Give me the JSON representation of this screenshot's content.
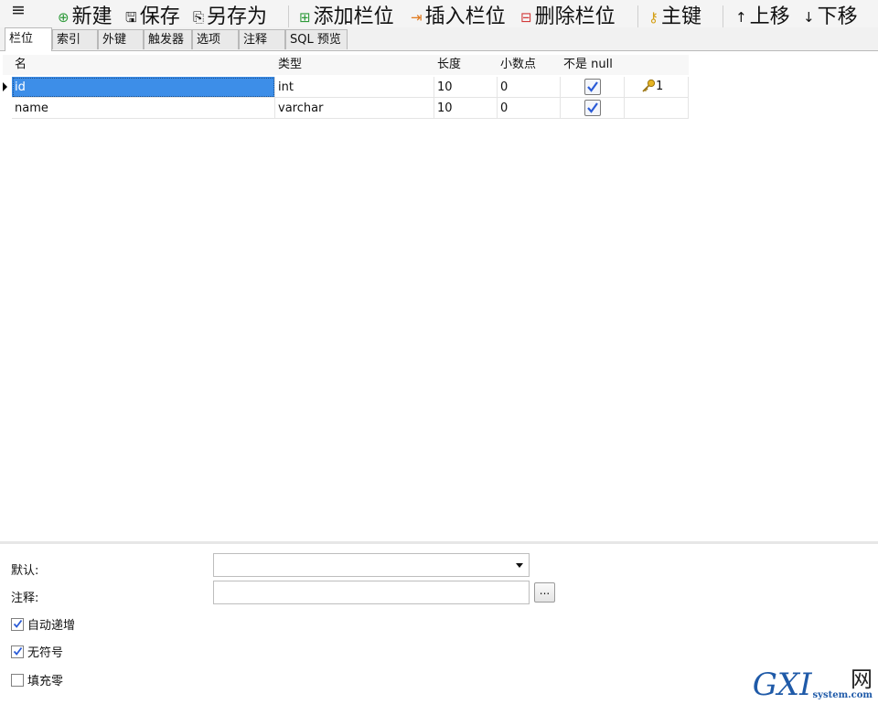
{
  "toolbar": {
    "menu_icon": "≡",
    "buttons": [
      {
        "label": "新建"
      },
      {
        "label": "保存"
      },
      {
        "label": "另存为"
      },
      {
        "label": "添加栏位"
      },
      {
        "label": "插入栏位"
      },
      {
        "label": "删除栏位"
      },
      {
        "label": "主键"
      },
      {
        "label": "上移"
      },
      {
        "label": "下移"
      }
    ]
  },
  "tabs": [
    {
      "label": "栏位",
      "active": true
    },
    {
      "label": "索引"
    },
    {
      "label": "外键"
    },
    {
      "label": "触发器"
    },
    {
      "label": "选项"
    },
    {
      "label": "注释"
    },
    {
      "label": "SQL 预览"
    }
  ],
  "grid": {
    "headers": [
      "名",
      "类型",
      "长度",
      "小数点",
      "不是 null"
    ],
    "rows": [
      {
        "name": "id",
        "type": "int",
        "length": "10",
        "decimals": "0",
        "not_null": true,
        "key": "1"
      },
      {
        "name": "name",
        "type": "varchar",
        "length": "10",
        "decimals": "0",
        "not_null": true,
        "key": ""
      }
    ]
  },
  "props": {
    "default_label": "默认:",
    "default_value": "",
    "comment_label": "注释:",
    "comment_value": "",
    "more_button": "...",
    "auto_increment_label": "自动递增",
    "auto_increment": true,
    "unsigned_label": "无符号",
    "unsigned": true,
    "zerofill_label": "填充零",
    "zerofill": false
  },
  "watermark": {
    "brand": "GXI",
    "suffix": "网",
    "domain": "system.com"
  },
  "colors": {
    "selection": "#3d8ee8",
    "check": "#2a5bd7",
    "key": "#d4a017"
  }
}
